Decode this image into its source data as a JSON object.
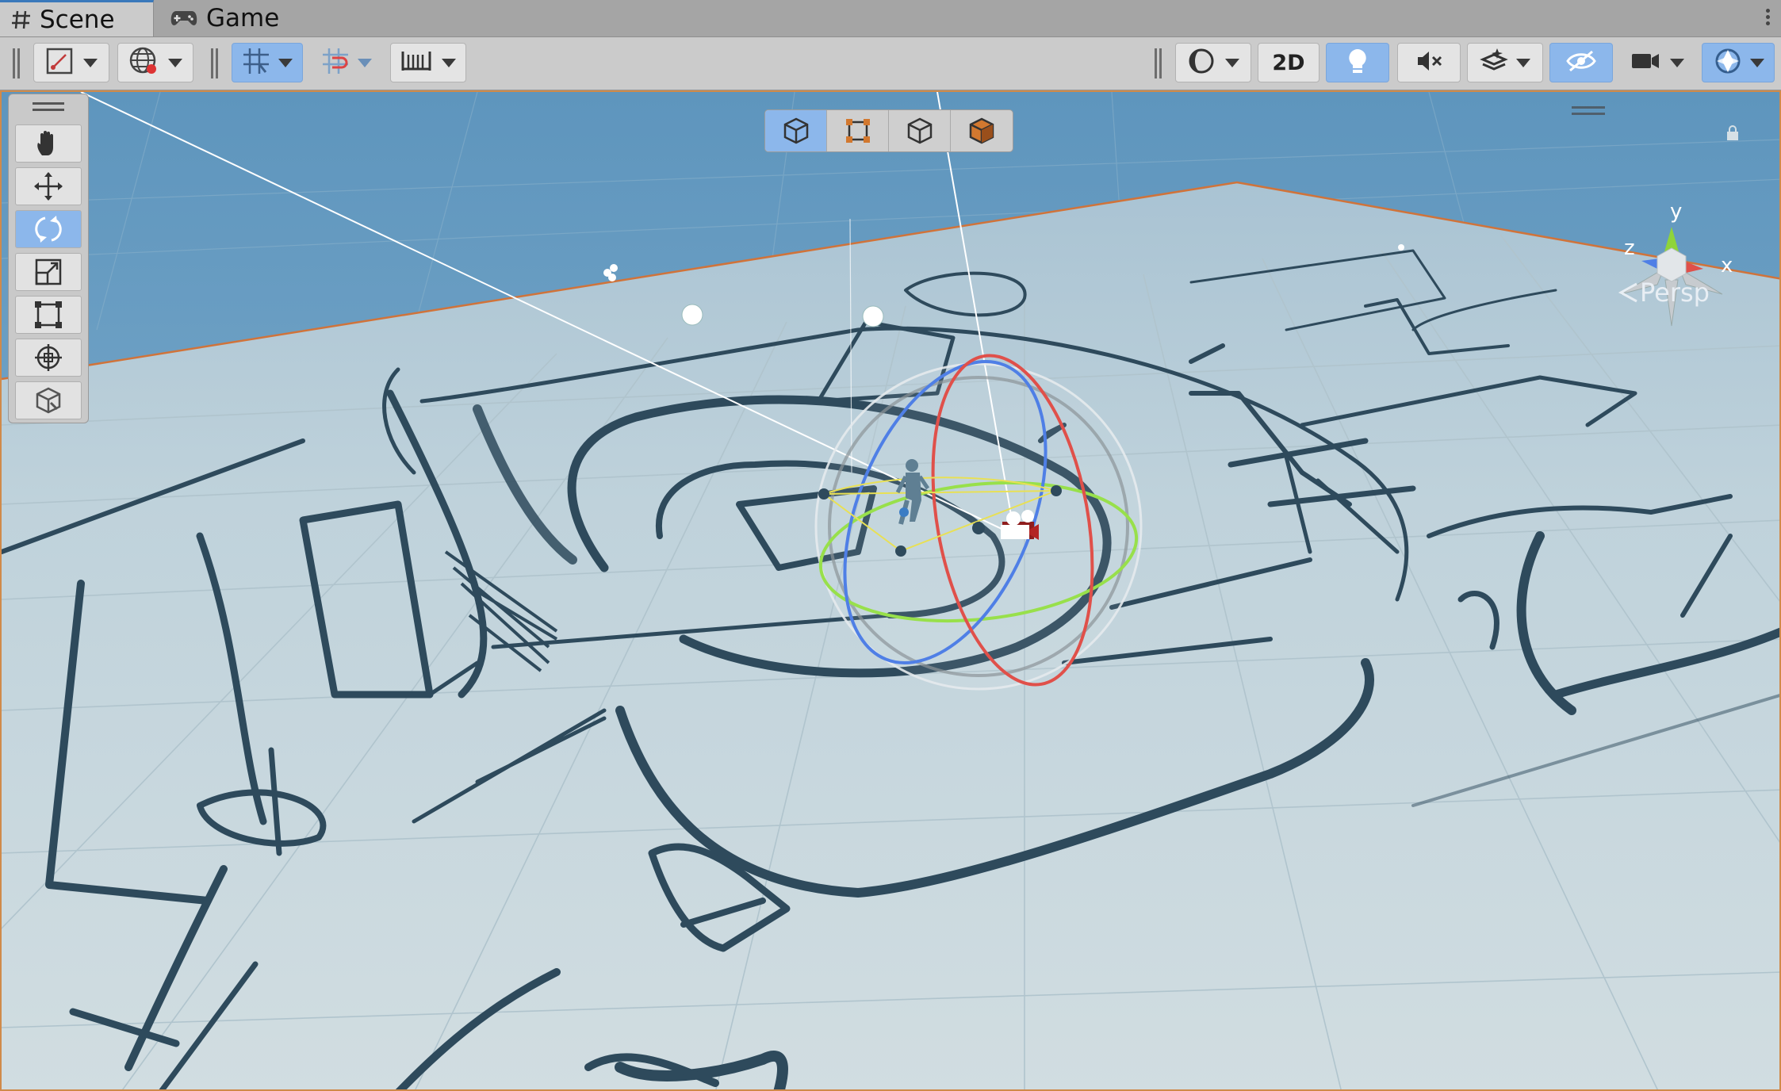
{
  "tabs": [
    {
      "label": "Scene",
      "icon": "grid-hash-icon",
      "active": true
    },
    {
      "label": "Game",
      "icon": "gamepad-icon",
      "active": false
    }
  ],
  "toolbar": {
    "left": [
      "draw-mode-icon",
      "global-icon",
      "grid-snap-icon",
      "increment-snap-icon",
      "ruler-icon"
    ],
    "right": [
      "shading-sphere-icon",
      "2D",
      "lighting-bulb-icon",
      "audio-mute-icon",
      "effects-layers-icon",
      "hidden-visibility-icon",
      "camera-icon",
      "gizmos-icon"
    ],
    "toggle_2d_label": "2D"
  },
  "tools": [
    "hand-tool",
    "move-tool",
    "rotate-tool",
    "scale-tool",
    "rect-tool",
    "transform-tool",
    "custom-editor-tool"
  ],
  "active_tool": "rotate-tool",
  "overlay_tools": [
    "cube-wire-icon",
    "rect-select-icon",
    "cube-outline-icon",
    "cube-solid-icon"
  ],
  "orientation_gizmo": {
    "x_label": "x",
    "y_label": "y",
    "z_label": "z",
    "projection": "Persp"
  },
  "colors": {
    "sky_top": "#6c9fc3",
    "ground": "#c7d6dc",
    "grid_line": "#b5c6cd",
    "sketch": "#2e4a5c",
    "x_axis": "#e0504a",
    "y_axis": "#8fd43a",
    "z_axis": "#4f7fe6",
    "selection_blue": "#8cb7eb"
  }
}
